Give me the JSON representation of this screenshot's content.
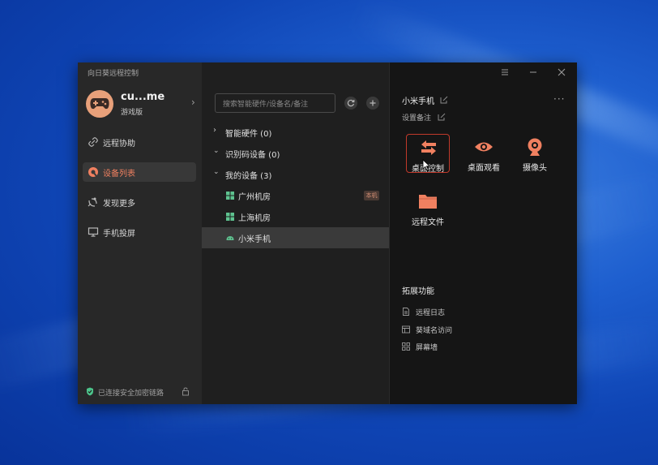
{
  "window": {
    "title": "向日葵远程控制"
  },
  "profile": {
    "name": "cu...me",
    "plan": "游戏版"
  },
  "nav": [
    {
      "label": "远程协助",
      "icon": "link-icon"
    },
    {
      "label": "设备列表",
      "icon": "device-list-icon",
      "active": true
    },
    {
      "label": "发现更多",
      "icon": "satellite-icon"
    },
    {
      "label": "手机投屏",
      "icon": "monitor-icon"
    }
  ],
  "footer": {
    "secure_text": "已连接安全加密链路"
  },
  "search": {
    "placeholder": "搜索智能硬件/设备名/备注"
  },
  "tree": {
    "groups": [
      {
        "label": "智能硬件 (0)",
        "expanded": false
      },
      {
        "label": "识别码设备 (0)",
        "expanded": true
      },
      {
        "label": "我的设备 (3)",
        "expanded": true
      }
    ],
    "devices": [
      {
        "label": "广州机房",
        "icon": "windows-icon",
        "badge": "本机"
      },
      {
        "label": "上海机房",
        "icon": "windows-icon",
        "badge": ""
      },
      {
        "label": "小米手机",
        "icon": "android-icon",
        "selected": true
      }
    ]
  },
  "detail": {
    "device_name": "小米手机",
    "note_label": "设置备注",
    "more": "···",
    "functions": [
      {
        "label": "桌面控制",
        "icon": "swap-arrows-icon",
        "highlighted": true
      },
      {
        "label": "桌面观看",
        "icon": "eye-icon"
      },
      {
        "label": "摄像头",
        "icon": "webcam-icon"
      },
      {
        "label": "远程文件",
        "icon": "folder-icon"
      }
    ],
    "extensions_title": "拓展功能",
    "extensions": [
      {
        "label": "远程日志",
        "icon": "document-icon"
      },
      {
        "label": "葵域名访问",
        "icon": "browser-icon"
      },
      {
        "label": "屏幕墙",
        "icon": "grid-icon"
      }
    ]
  },
  "colors": {
    "accent": "#f08060",
    "sidebar": "#282828",
    "panel": "#1f1f1f",
    "detail": "#151515"
  }
}
